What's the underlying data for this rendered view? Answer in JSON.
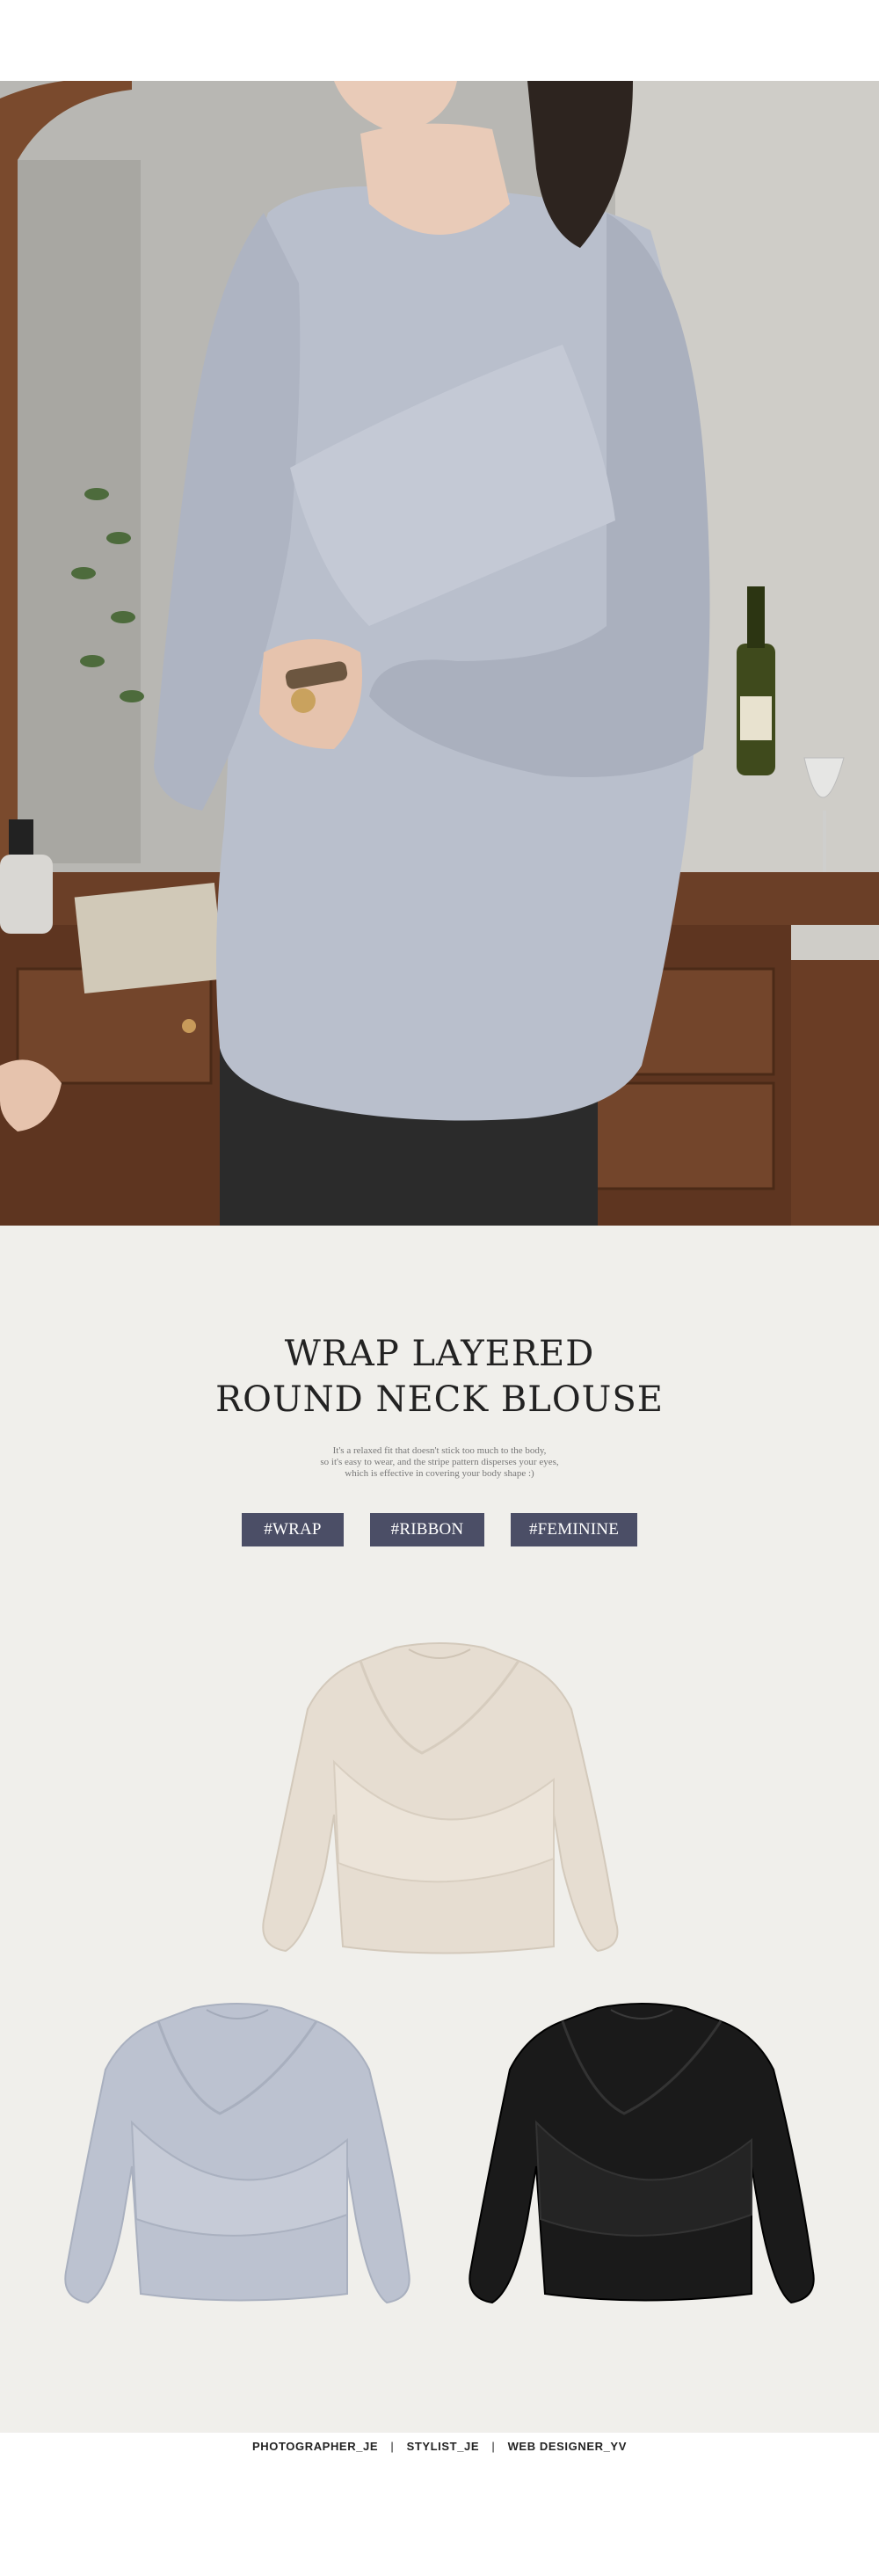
{
  "hero": {
    "alt": "model wearing blue wrap layered blouse",
    "colors": {
      "wall": "#8d8c88",
      "blouse": "#b9bfcc",
      "desk": "#6b3f27"
    }
  },
  "intro": {
    "title_line1": "WRAP LAYERED",
    "title_line2": "ROUND NECK BLOUSE",
    "desc_line1": "It's a relaxed fit that doesn't stick too much to the body,",
    "desc_line2": "so it's easy to wear, and the stripe pattern disperses your eyes,",
    "desc_line3": "which is effective in covering your body shape :)",
    "tags": [
      "#WRAP",
      "#RIBBON",
      "#FEMININE"
    ],
    "tag_color": "#4b4e66",
    "background": "#f0efeb"
  },
  "products": [
    {
      "color_name": "beige",
      "hex": "#e6ddd1"
    },
    {
      "color_name": "blue",
      "hex": "#bcc2d0"
    },
    {
      "color_name": "black",
      "hex": "#1a1a1a"
    }
  ],
  "footer": {
    "photographer": "PHOTOGRAPHER_JE",
    "stylist": "STYLIST_JE",
    "designer": "WEB DESIGNER_YV",
    "separator": "|"
  }
}
